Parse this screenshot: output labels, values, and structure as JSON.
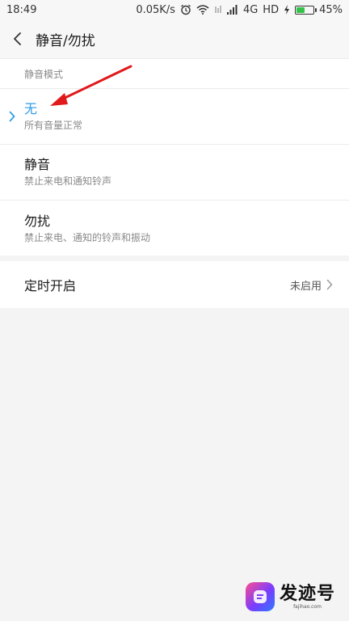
{
  "status_bar": {
    "time": "18:49",
    "speed": "0.05K/s",
    "network": "4G",
    "hd": "HD",
    "battery": "45%",
    "battery_level": 0.45
  },
  "header": {
    "title": "静音/勿扰"
  },
  "modes": {
    "section_title": "静音模式",
    "items": [
      {
        "title": "无",
        "desc": "所有音量正常",
        "selected": true
      },
      {
        "title": "静音",
        "desc": "禁止来电和通知铃声",
        "selected": false
      },
      {
        "title": "勿扰",
        "desc": "禁止来电、通知的铃声和振动",
        "selected": false
      }
    ]
  },
  "timer": {
    "label": "定时开启",
    "value": "未启用"
  },
  "watermark": {
    "text": "发迹号",
    "sub": "fajihao.com"
  },
  "colors": {
    "accent": "#2e9be9",
    "annotation": "#e0191b",
    "background": "#f4f4f4",
    "card": "#ffffff"
  }
}
